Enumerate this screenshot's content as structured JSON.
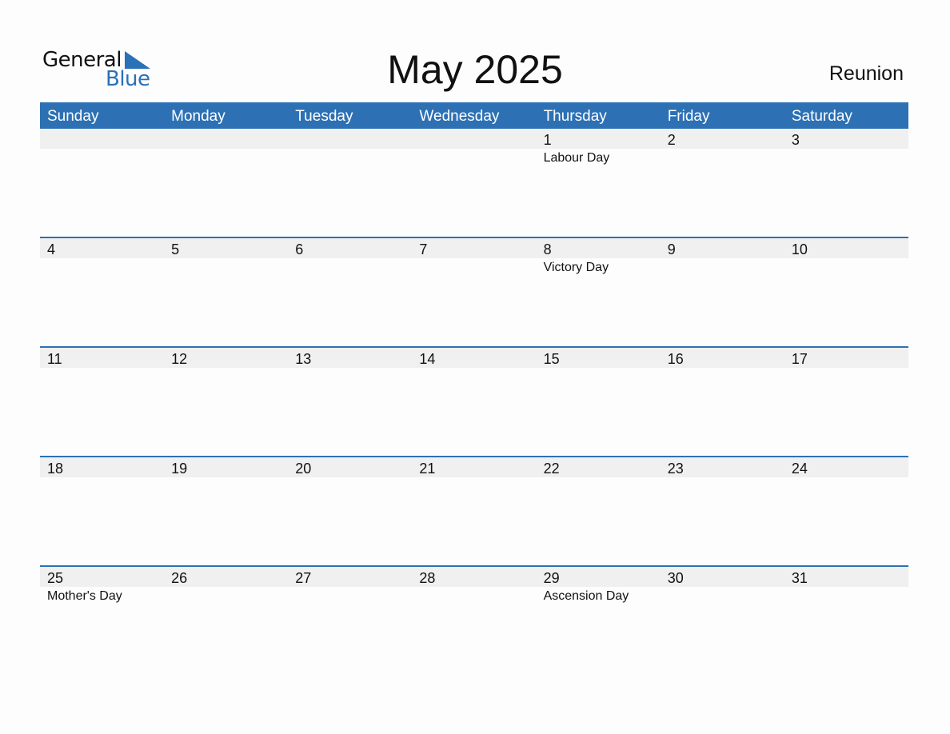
{
  "logo": {
    "text_top": "General",
    "text_bottom": "Blue",
    "icon": "triangle-flag-icon",
    "color": "#2a71b8"
  },
  "title": "May 2025",
  "country": "Reunion",
  "colors": {
    "header_bg": "#2d71b4",
    "date_bar": "#f0f0f0"
  },
  "weekdays": [
    "Sunday",
    "Monday",
    "Tuesday",
    "Wednesday",
    "Thursday",
    "Friday",
    "Saturday"
  ],
  "weeks": [
    [
      {
        "day": "",
        "holiday": ""
      },
      {
        "day": "",
        "holiday": ""
      },
      {
        "day": "",
        "holiday": ""
      },
      {
        "day": "",
        "holiday": ""
      },
      {
        "day": "1",
        "holiday": "Labour Day"
      },
      {
        "day": "2",
        "holiday": ""
      },
      {
        "day": "3",
        "holiday": ""
      }
    ],
    [
      {
        "day": "4",
        "holiday": ""
      },
      {
        "day": "5",
        "holiday": ""
      },
      {
        "day": "6",
        "holiday": ""
      },
      {
        "day": "7",
        "holiday": ""
      },
      {
        "day": "8",
        "holiday": "Victory Day"
      },
      {
        "day": "9",
        "holiday": ""
      },
      {
        "day": "10",
        "holiday": ""
      }
    ],
    [
      {
        "day": "11",
        "holiday": ""
      },
      {
        "day": "12",
        "holiday": ""
      },
      {
        "day": "13",
        "holiday": ""
      },
      {
        "day": "14",
        "holiday": ""
      },
      {
        "day": "15",
        "holiday": ""
      },
      {
        "day": "16",
        "holiday": ""
      },
      {
        "day": "17",
        "holiday": ""
      }
    ],
    [
      {
        "day": "18",
        "holiday": ""
      },
      {
        "day": "19",
        "holiday": ""
      },
      {
        "day": "20",
        "holiday": ""
      },
      {
        "day": "21",
        "holiday": ""
      },
      {
        "day": "22",
        "holiday": ""
      },
      {
        "day": "23",
        "holiday": ""
      },
      {
        "day": "24",
        "holiday": ""
      }
    ],
    [
      {
        "day": "25",
        "holiday": "Mother's Day"
      },
      {
        "day": "26",
        "holiday": ""
      },
      {
        "day": "27",
        "holiday": ""
      },
      {
        "day": "28",
        "holiday": ""
      },
      {
        "day": "29",
        "holiday": "Ascension Day"
      },
      {
        "day": "30",
        "holiday": ""
      },
      {
        "day": "31",
        "holiday": ""
      }
    ]
  ]
}
